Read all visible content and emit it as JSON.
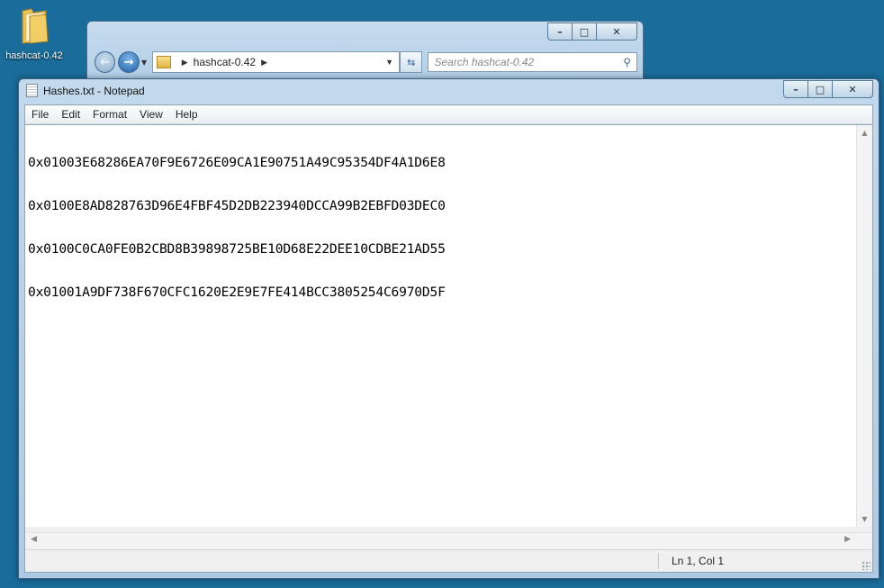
{
  "desktop": {
    "icons": [
      {
        "label": "hashcat-0.42",
        "icon": "folder-icon"
      }
    ]
  },
  "explorer": {
    "breadcrumb": "hashcat-0.42",
    "search_placeholder": "Search hashcat-0.42",
    "buttons": {
      "minimize": "–",
      "maximize": "□",
      "close": "✕"
    }
  },
  "notepad": {
    "title": "Hashes.txt - Notepad",
    "buttons": {
      "minimize": "–",
      "maximize": "□",
      "close": "✕"
    },
    "menu": [
      "File",
      "Edit",
      "Format",
      "View",
      "Help"
    ],
    "lines": [
      "0x01003E68286EA70F9E6726E09CA1E90751A49C95354DF4A1D6E8",
      "0x0100E8AD828763D96E4FBF45D2DB223940DCCA99B2EBFD03DEC0",
      "0x0100C0CA0FE0B2CBD8B39898725BE10D68E22DEE10CDBE21AD55",
      "0x01001A9DF738F670CFC1620E2E9E7FE414BCC3805254C6970D5F"
    ],
    "status": {
      "position": "Ln 1, Col 1"
    }
  },
  "colors": {
    "desktop": "#1a6c9a",
    "title_bar": "#c3d9ec",
    "text": "#000000"
  }
}
